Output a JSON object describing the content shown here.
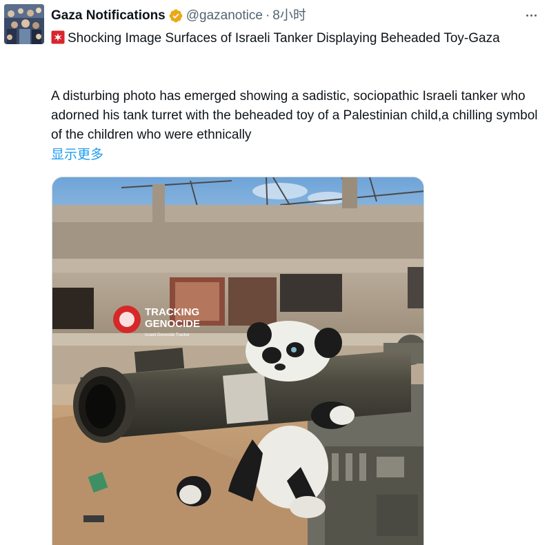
{
  "account": {
    "display_name": "Gaza Notifications",
    "handle": "@gazanotice",
    "separator": "·",
    "timestamp": "8小时",
    "verified_badge_color": "#e9a916"
  },
  "post": {
    "title_emoji": "siren-emoji",
    "title": "Shocking Image Surfaces of Israeli Tanker Displaying Beheaded Toy-Gaza",
    "body": "A disturbing photo has emerged showing a sadistic, sociopathic Israeli tanker who adorned his tank turret with the beheaded toy of a Palestinian child,a chilling symbol of the children who were ethnically",
    "show_more": "显示更多"
  },
  "media": {
    "watermark_title_line1": "TRACKING",
    "watermark_title_line2": "GENOCIDE",
    "watermark_subtitle": "Israeli Genocide Tracker",
    "watermark_color": "#d62828"
  },
  "colors": {
    "link": "#1d9bf0",
    "secondary_text": "#536471",
    "primary_text": "#0f1419"
  }
}
